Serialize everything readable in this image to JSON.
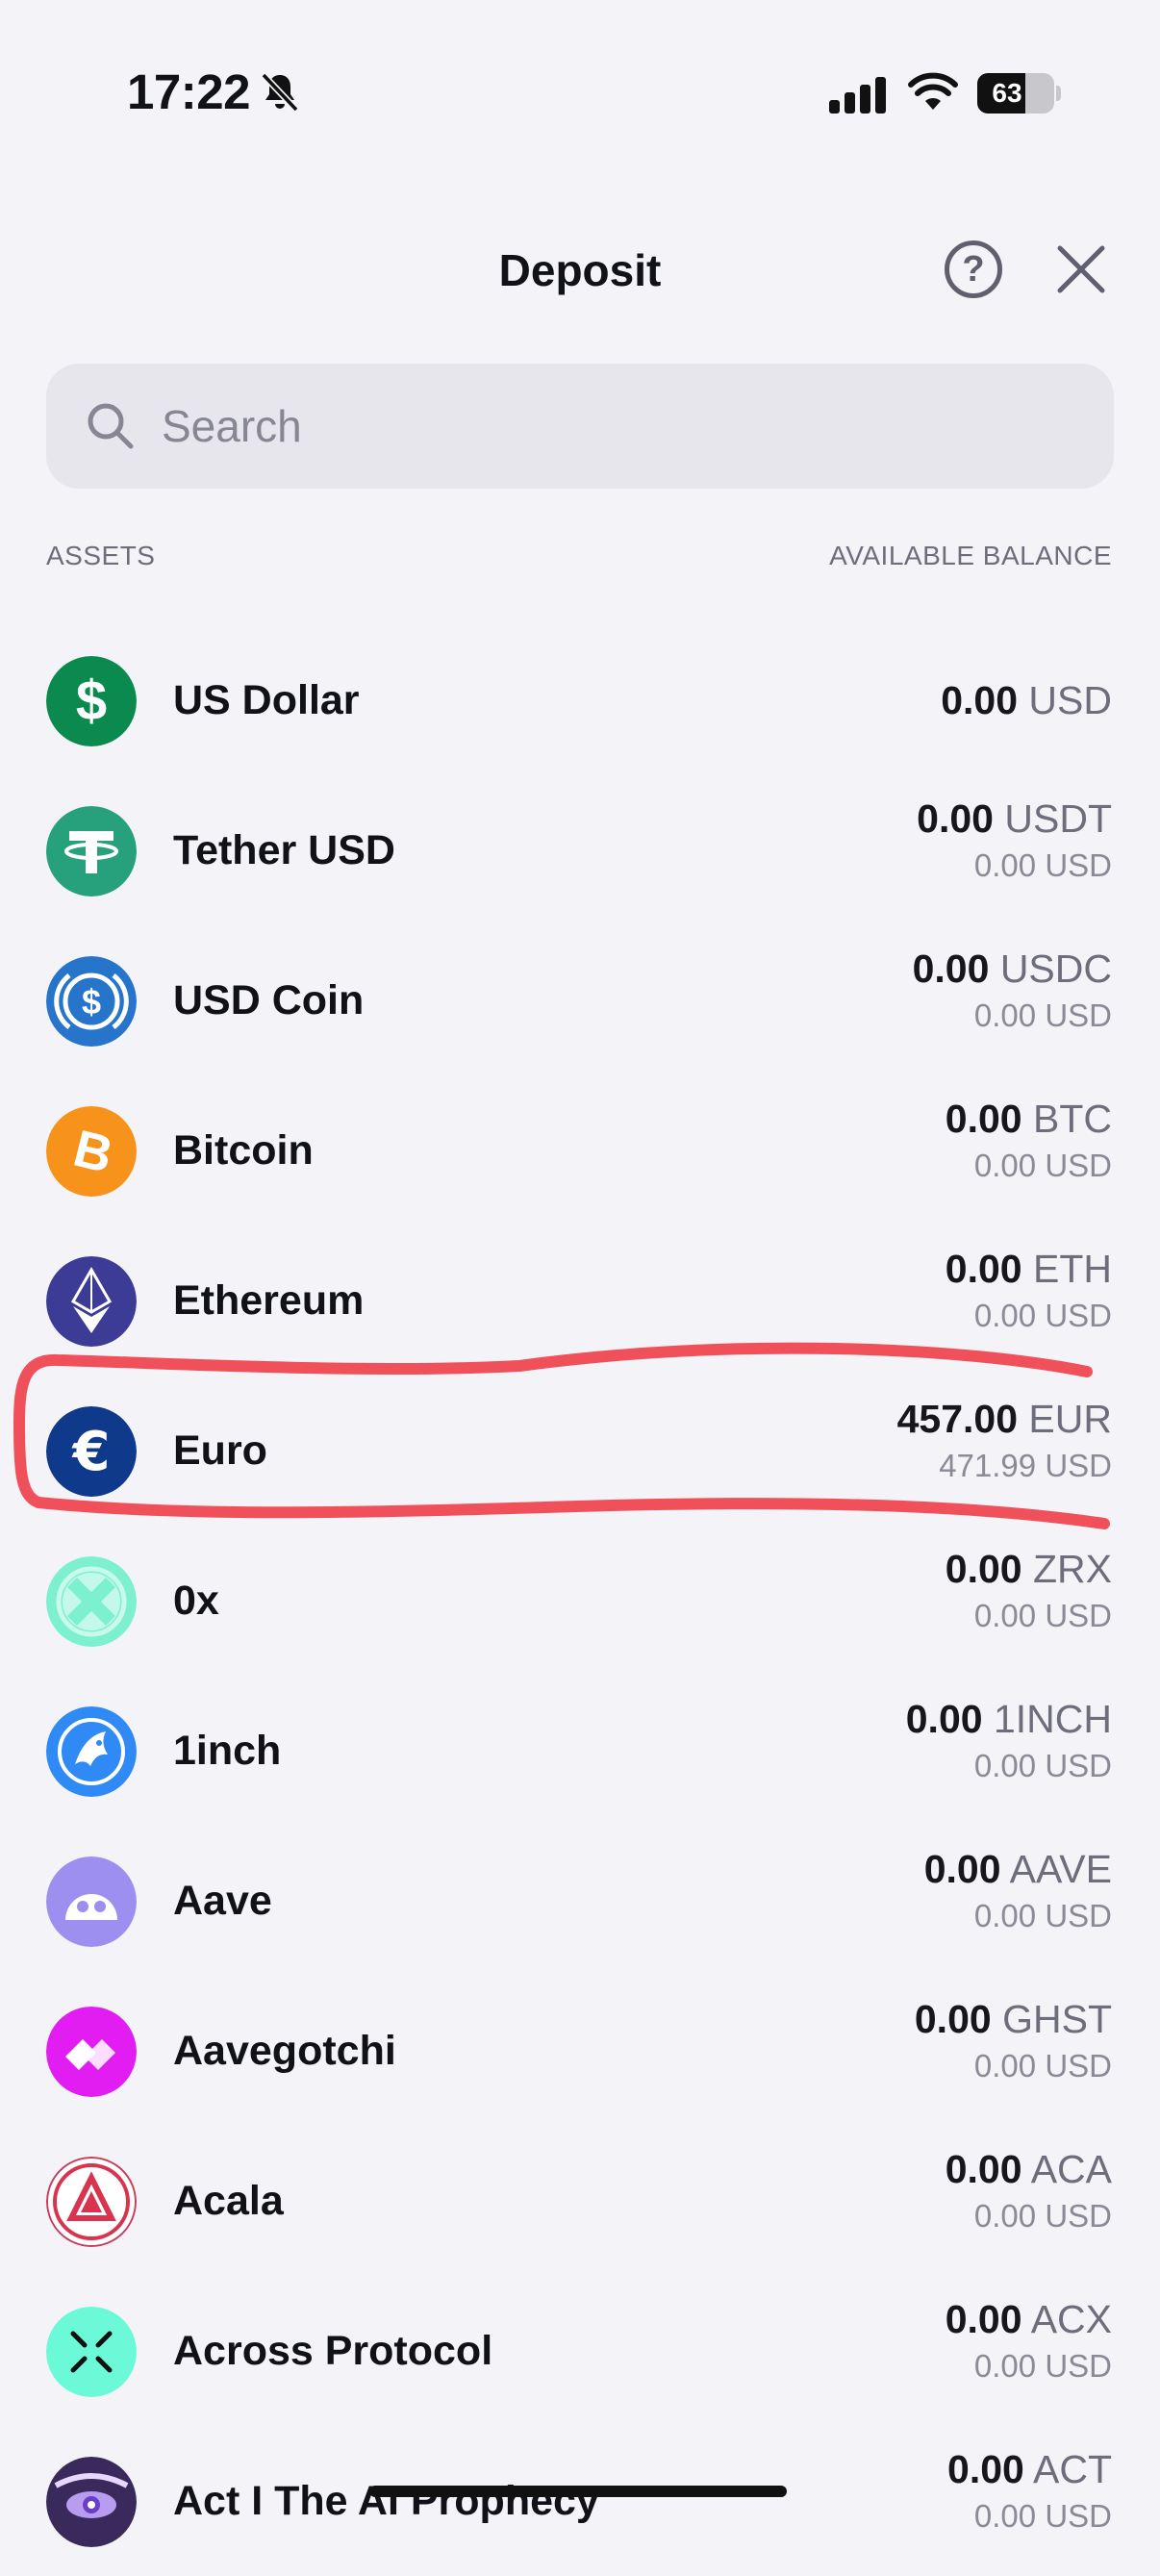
{
  "status_bar": {
    "time": "17:22",
    "battery": "63",
    "battery_level": 0.63
  },
  "header": {
    "title": "Deposit"
  },
  "search": {
    "placeholder": "Search"
  },
  "columns": {
    "assets": "ASSETS",
    "balance": "AVAILABLE BALANCE"
  },
  "assets": [
    {
      "name": "US Dollar",
      "amount": "0.00",
      "currency": "USD",
      "icon": "us-dollar-icon"
    },
    {
      "name": "Tether USD",
      "amount": "0.00",
      "currency": "USDT",
      "usd": "0.00",
      "usd_label": "USD",
      "icon": "tether-icon"
    },
    {
      "name": "USD Coin",
      "amount": "0.00",
      "currency": "USDC",
      "usd": "0.00",
      "usd_label": "USD",
      "icon": "usd-coin-icon"
    },
    {
      "name": "Bitcoin",
      "amount": "0.00",
      "currency": "BTC",
      "usd": "0.00",
      "usd_label": "USD",
      "icon": "bitcoin-icon"
    },
    {
      "name": "Ethereum",
      "amount": "0.00",
      "currency": "ETH",
      "usd": "0.00",
      "usd_label": "USD",
      "icon": "ethereum-icon"
    },
    {
      "name": "Euro",
      "amount": "457.00",
      "currency": "EUR",
      "usd": "471.99",
      "usd_label": "USD",
      "icon": "euro-icon"
    },
    {
      "name": "0x",
      "amount": "0.00",
      "currency": "ZRX",
      "usd": "0.00",
      "usd_label": "USD",
      "icon": "zrx-icon"
    },
    {
      "name": "1inch",
      "amount": "0.00",
      "currency": "1INCH",
      "usd": "0.00",
      "usd_label": "USD",
      "icon": "1inch-icon"
    },
    {
      "name": "Aave",
      "amount": "0.00",
      "currency": "AAVE",
      "usd": "0.00",
      "usd_label": "USD",
      "icon": "aave-icon"
    },
    {
      "name": "Aavegotchi",
      "amount": "0.00",
      "currency": "GHST",
      "usd": "0.00",
      "usd_label": "USD",
      "icon": "aavegotchi-icon"
    },
    {
      "name": "Acala",
      "amount": "0.00",
      "currency": "ACA",
      "usd": "0.00",
      "usd_label": "USD",
      "icon": "acala-icon"
    },
    {
      "name": "Across Protocol",
      "amount": "0.00",
      "currency": "ACX",
      "usd": "0.00",
      "usd_label": "USD",
      "icon": "across-protocol-icon"
    },
    {
      "name": "Act I The AI Prophecy",
      "amount": "0.00",
      "currency": "ACT",
      "usd": "0.00",
      "usd_label": "USD",
      "icon": "act-icon"
    }
  ],
  "colors": {
    "highlight": "#f0505a",
    "background": "#f4f3f8",
    "search_bg": "#e7e6ec"
  }
}
